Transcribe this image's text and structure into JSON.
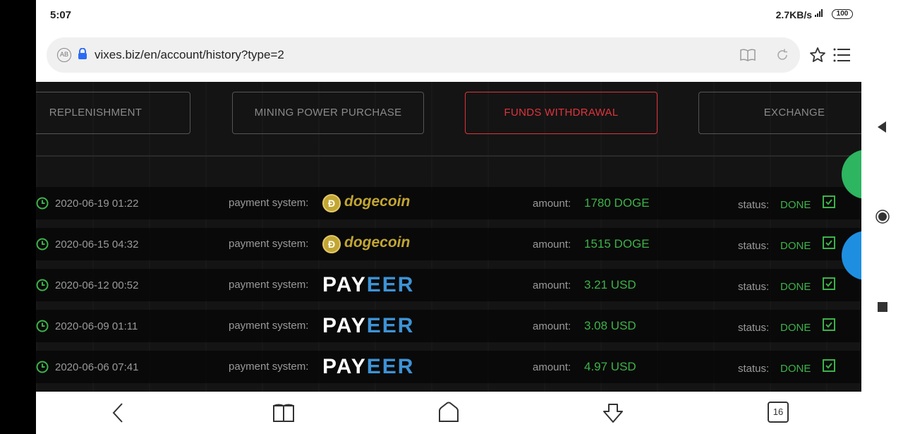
{
  "status_bar": {
    "time": "5:07",
    "network_speed": "2.7KB/s",
    "network_type": "4G",
    "battery": "100"
  },
  "browser": {
    "url": "vixes.biz/en/account/history?type=2",
    "tab_count": "16"
  },
  "tabs": [
    {
      "label": "REPLENISHMENT",
      "active": false
    },
    {
      "label": "MINING POWER PURCHASE",
      "active": false
    },
    {
      "label": "FUNDS WITHDRAWAL",
      "active": true
    },
    {
      "label": "EXCHANGE",
      "active": false
    }
  ],
  "labels": {
    "payment_system": "payment system:",
    "amount": "amount:",
    "status": "status:"
  },
  "rows": [
    {
      "date": "2020-06-19 01:22",
      "system": "dogecoin",
      "amount": "1780 DOGE",
      "status": "DONE"
    },
    {
      "date": "2020-06-15 04:32",
      "system": "dogecoin",
      "amount": "1515 DOGE",
      "status": "DONE"
    },
    {
      "date": "2020-06-12 00:52",
      "system": "PAYEER",
      "amount": "3.21 USD",
      "status": "DONE"
    },
    {
      "date": "2020-06-09 01:11",
      "system": "PAYEER",
      "amount": "3.08 USD",
      "status": "DONE"
    },
    {
      "date": "2020-06-06 07:41",
      "system": "PAYEER",
      "amount": "4.97 USD",
      "status": "DONE"
    }
  ],
  "logos": {
    "dogecoin_text": "dogecoin",
    "payeer_part1": "PAY",
    "payeer_part2": "EER"
  },
  "colors": {
    "accent_red": "#e0343c",
    "done_green": "#3db24a",
    "dogecoin_gold": "#c2a633",
    "payeer_blue": "#3d93d6"
  }
}
